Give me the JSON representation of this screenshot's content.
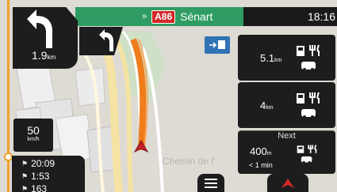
{
  "header": {
    "chevron": "»",
    "road_number": "A86",
    "street_name": "Sénart",
    "clock": "18:16"
  },
  "next_turn": {
    "distance": "1.9",
    "unit": "km",
    "icon": "turn-left-arrow-icon"
  },
  "second_turn": {
    "icon": "turn-right-arrow-icon"
  },
  "services": [
    {
      "distance": "5.1",
      "unit": "km",
      "icons": [
        "fuel-icon",
        "restaurant-icon",
        "car-service-icon"
      ]
    },
    {
      "distance": "4",
      "unit": "km",
      "icons": [
        "fuel-icon",
        "restaurant-icon",
        "car-service-icon"
      ]
    },
    {
      "label": "Next",
      "distance": "400",
      "unit": "m",
      "eta": "< 1 min",
      "icons": [
        "fuel-icon",
        "restaurant-icon",
        "car-service-icon"
      ]
    }
  ],
  "speed": {
    "value": "50",
    "unit": "km/h"
  },
  "trip": {
    "arrival": "20:09",
    "remaining_time": "1:53",
    "remaining_distance": "163"
  },
  "map": {
    "street_label": "Chemin de l'"
  },
  "colors": {
    "route": "#ef7d1c",
    "green_bar": "#2f9d63",
    "panel": "#1d1d1d",
    "accent_red": "#d42727"
  }
}
